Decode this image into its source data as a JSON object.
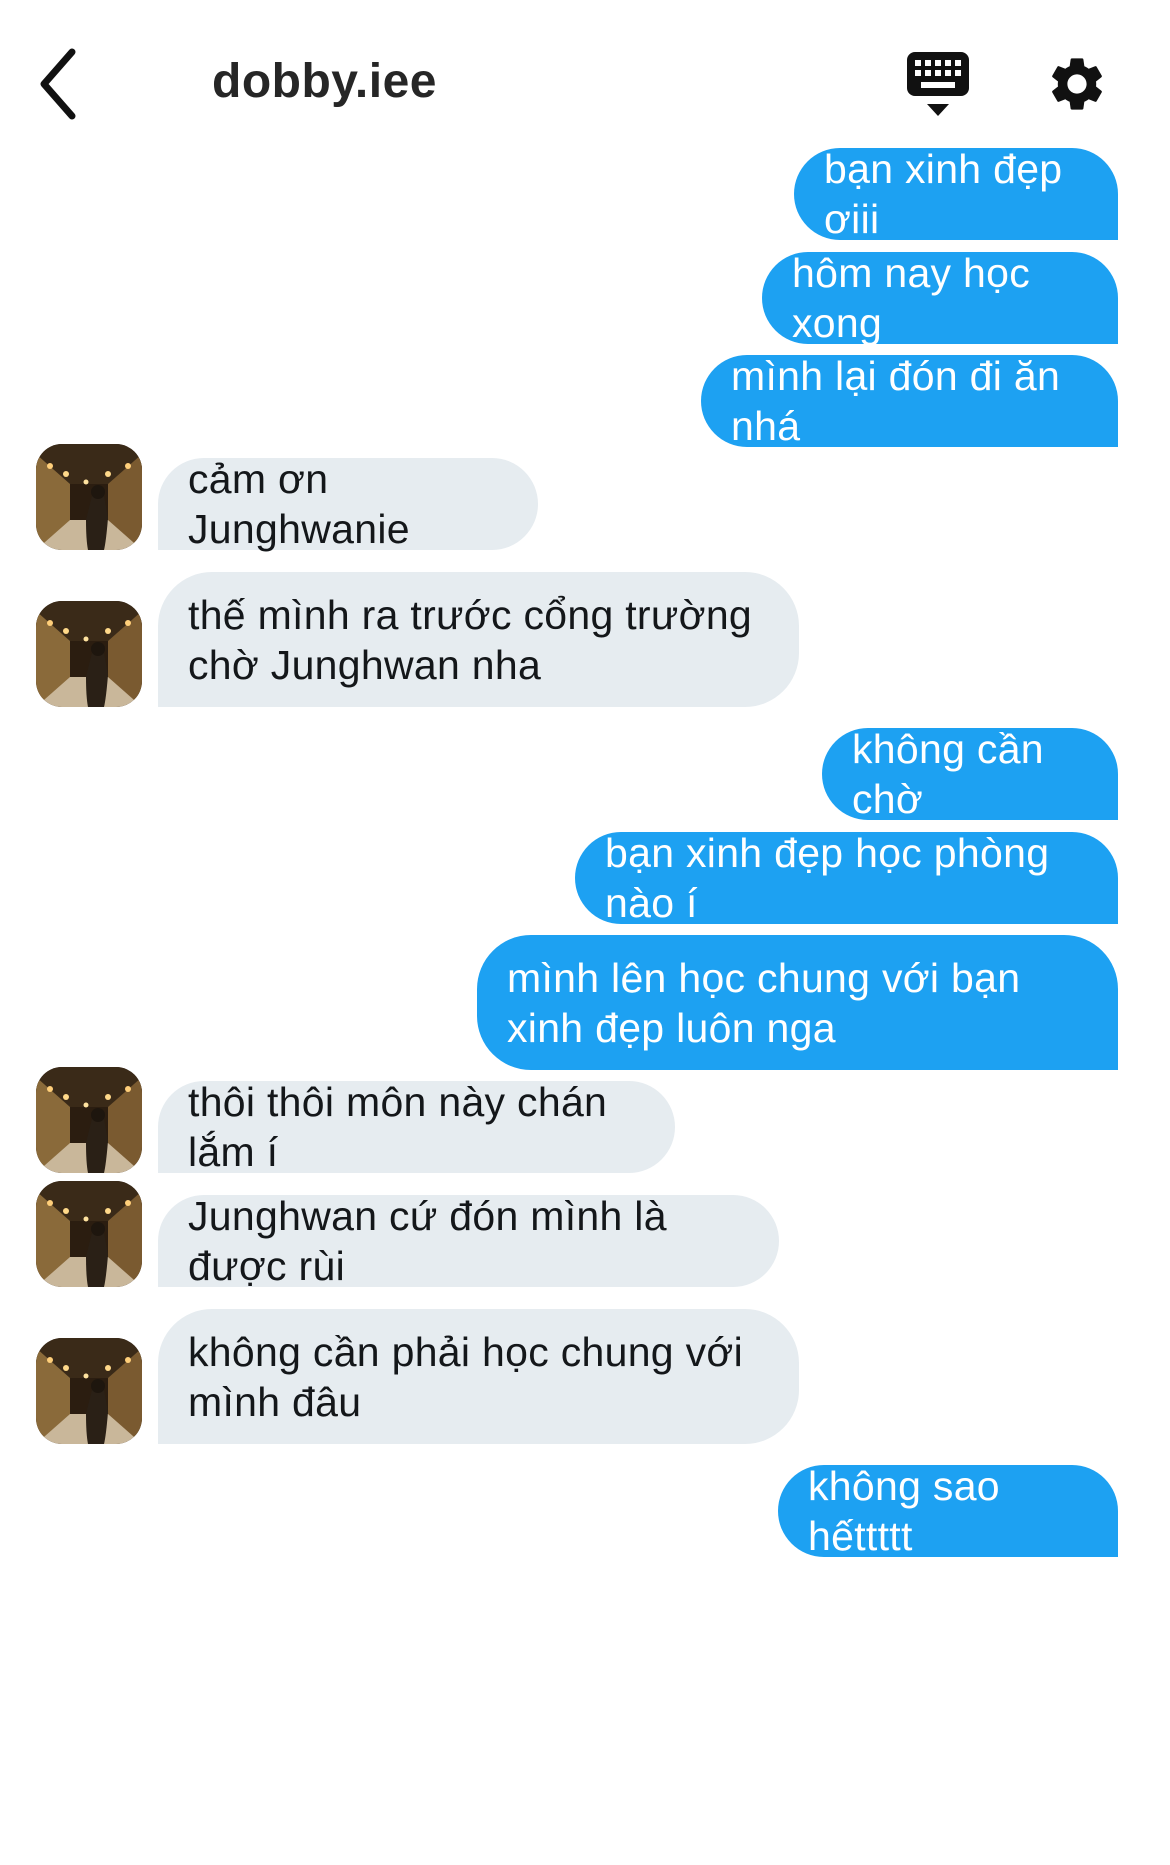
{
  "header": {
    "back_icon": "chevron-left-icon",
    "username": "dobby.iee",
    "keyboard_icon": "keyboard-icon",
    "settings_icon": "gear-icon"
  },
  "colors": {
    "outgoing_bubble": "#1da1f2",
    "incoming_bubble": "#e6ecf0",
    "outgoing_text": "#ffffff",
    "incoming_text": "#14171a"
  },
  "messages": [
    {
      "side": "out",
      "text": "bạn xinh đẹp ơiii"
    },
    {
      "side": "out",
      "text": "hôm nay học xong"
    },
    {
      "side": "out",
      "text": "mình lại đón đi ăn nhá"
    },
    {
      "side": "in",
      "text": "cảm ơn Junghwanie"
    },
    {
      "side": "in",
      "text": "thế mình ra trước cổng trường chờ Junghwan nha"
    },
    {
      "side": "out",
      "text": "không cần chờ"
    },
    {
      "side": "out",
      "text": "bạn xinh đẹp học phòng nào í"
    },
    {
      "side": "out",
      "text": "mình lên học chung với bạn xinh đẹp luôn nga"
    },
    {
      "side": "in",
      "text": "thôi thôi môn này chán lắm í"
    },
    {
      "side": "in",
      "text": "Junghwan cứ đón mình là được rùi"
    },
    {
      "side": "in",
      "text": "không cần phải học chung với mình đâu"
    },
    {
      "side": "out",
      "text": "không sao hếttttt"
    }
  ]
}
